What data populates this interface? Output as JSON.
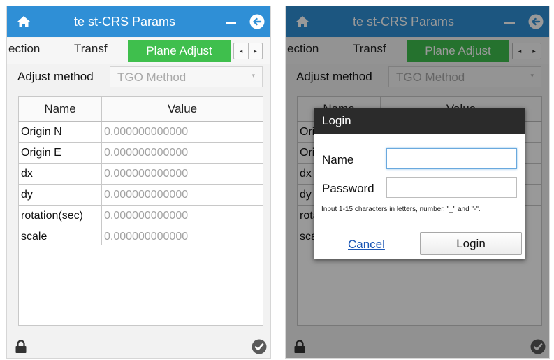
{
  "app": {
    "title": "te st-CRS Params",
    "icons": {
      "home": "home-icon",
      "minimize": "minimize-icon",
      "back": "back-arrow-icon",
      "lock": "lock-icon",
      "confirm": "checkmark-icon"
    },
    "colors": {
      "titlebar": "#2f8fd6",
      "active_tab": "#3fbf4d",
      "dialog_header": "#2b2b2b",
      "link": "#1a56b5"
    }
  },
  "tabs": {
    "items": [
      {
        "label": "ection"
      },
      {
        "label": "Transf"
      }
    ],
    "active": "Plane Adjust",
    "prev_symbol": "◂",
    "next_symbol": "▸"
  },
  "adjust": {
    "label": "Adjust method",
    "selected": "TGO Method",
    "caret": "▾"
  },
  "table": {
    "headers": [
      "Name",
      "Value"
    ],
    "rows": [
      {
        "name": "Origin N",
        "value": "0.000000000000"
      },
      {
        "name": "Origin E",
        "value": "0.000000000000"
      },
      {
        "name": "dx",
        "value": "0.000000000000"
      },
      {
        "name": "dy",
        "value": "0.000000000000"
      },
      {
        "name": "rotation(sec)",
        "value": "0.000000000000"
      },
      {
        "name": "scale",
        "value": "0.000000000000"
      }
    ]
  },
  "login_dialog": {
    "title": "Login",
    "name_label": "Name",
    "name_value": "",
    "password_label": "Password",
    "password_value": "",
    "hint": "Input 1-15 characters in letters, number, \"_\" and \"-\".",
    "cancel_label": "Cancel",
    "login_label": "Login"
  }
}
